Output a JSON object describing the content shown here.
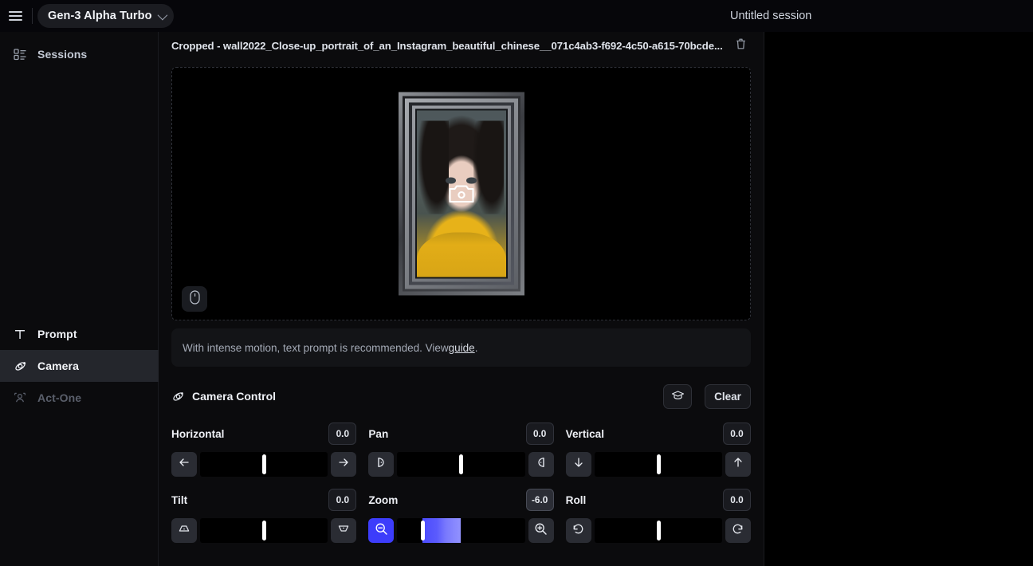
{
  "topbar": {
    "menu_icon": "hamburger-icon",
    "model_selector": {
      "label": "Gen-3 Alpha Turbo",
      "chevron_icon": "chevron-down-icon"
    },
    "session_title": "Untitled session"
  },
  "sidebar": {
    "sessions": {
      "label": "Sessions",
      "icon": "list-layout-icon"
    },
    "items": [
      {
        "label": "Prompt",
        "icon": "text-type-icon",
        "state": "normal"
      },
      {
        "label": "Camera",
        "icon": "camera-orbit-icon",
        "state": "selected"
      },
      {
        "label": "Act-One",
        "icon": "person-performance-icon",
        "state": "disabled"
      }
    ]
  },
  "asset": {
    "title": "Cropped - wall2022_Close-up_portrait_of_an_Instagram_beautiful_chinese__071c4ab3-f692-4c50-a615-70bcde...",
    "delete_icon": "trash-icon",
    "preview": {
      "camera_overlay_icon": "camera-icon",
      "mouse_badge_icon": "mouse-icon",
      "alt": "Framed portrait of a woman with dark curly hair wearing a yellow sweater"
    }
  },
  "hint": {
    "text_before": "With intense motion, text prompt is recommended. View ",
    "link": "guide",
    "text_after": "."
  },
  "camera_control": {
    "icon": "camera-orbit-icon",
    "title": "Camera Control",
    "learn_button": {
      "label": "",
      "icon": "graduation-cap-icon"
    },
    "clear_button": {
      "label": "Clear"
    },
    "controls": [
      {
        "name": "Horizontal",
        "value": "0.0",
        "value_active": false,
        "percent": 50,
        "fill_percent": 0,
        "dec_icon": "arrow-left-icon",
        "inc_icon": "arrow-right-icon",
        "dec_active": false,
        "inc_active": false
      },
      {
        "name": "Pan",
        "value": "0.0",
        "value_active": false,
        "percent": 50,
        "fill_percent": 0,
        "dec_icon": "pan-left-icon",
        "inc_icon": "pan-right-icon",
        "dec_active": false,
        "inc_active": false
      },
      {
        "name": "Vertical",
        "value": "0.0",
        "value_active": false,
        "percent": 50,
        "fill_percent": 0,
        "dec_icon": "arrow-down-icon",
        "inc_icon": "arrow-up-icon",
        "dec_active": false,
        "inc_active": false
      },
      {
        "name": "Tilt",
        "value": "0.0",
        "value_active": false,
        "percent": 50,
        "fill_percent": 0,
        "dec_icon": "tilt-up-icon",
        "inc_icon": "tilt-down-icon",
        "dec_active": false,
        "inc_active": false
      },
      {
        "name": "Zoom",
        "value": "-6.0",
        "value_active": true,
        "percent": 20,
        "fill_percent": 30,
        "dec_icon": "zoom-out-icon",
        "inc_icon": "zoom-in-icon",
        "dec_active": true,
        "inc_active": false
      },
      {
        "name": "Roll",
        "value": "0.0",
        "value_active": false,
        "percent": 50,
        "fill_percent": 0,
        "dec_icon": "rotate-ccw-icon",
        "inc_icon": "rotate-cw-icon",
        "dec_active": false,
        "inc_active": false
      }
    ]
  },
  "colors": {
    "accent": "#3d3dfb",
    "fill_start": "#4b4bfd",
    "fill_end": "#9292fe",
    "panel": "#0b0b0d",
    "selected_row": "#24262c"
  }
}
